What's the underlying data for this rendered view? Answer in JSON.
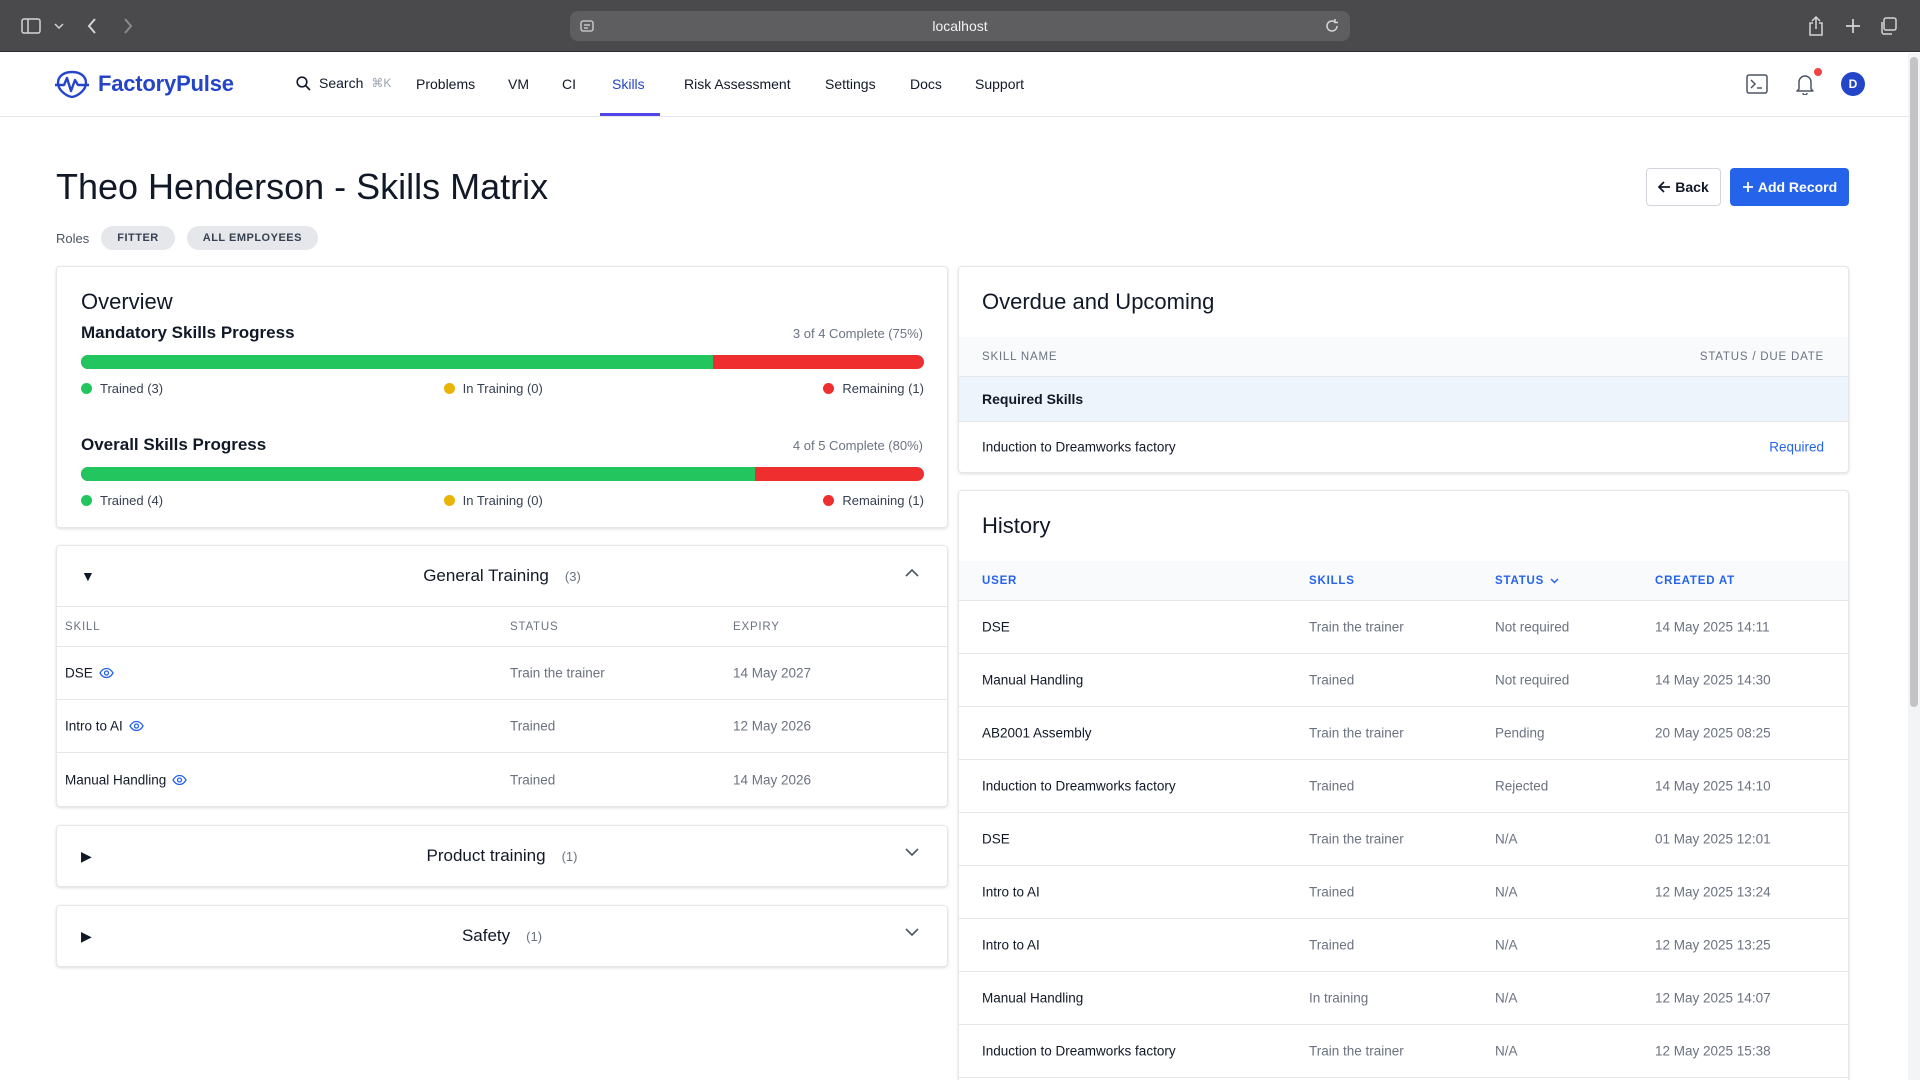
{
  "browser": {
    "url": "localhost"
  },
  "nav": {
    "brand": "FactoryPulse",
    "search_label": "Search",
    "search_shortcut": "⌘K",
    "items": [
      "Problems",
      "VM",
      "CI",
      "Skills",
      "Risk Assessment",
      "Settings",
      "Docs",
      "Support"
    ],
    "active": "Skills",
    "avatar_initial": "D"
  },
  "header": {
    "title": "Theo Henderson - Skills Matrix",
    "roles_label": "Roles",
    "roles": [
      "FITTER",
      "ALL EMPLOYEES"
    ],
    "back_label": "Back",
    "add_label": "Add Record"
  },
  "overview": {
    "title": "Overview",
    "mandatory": {
      "label": "Mandatory Skills Progress",
      "summary": "3 of 4 Complete (75%)",
      "fraction": 0.75,
      "trained": "Trained (3)",
      "in_training": "In Training (0)",
      "remaining": "Remaining (1)"
    },
    "overall": {
      "label": "Overall Skills Progress",
      "summary": "4 of 5 Complete (80%)",
      "fraction": 0.8,
      "trained": "Trained (4)",
      "in_training": "In Training (0)",
      "remaining": "Remaining (1)"
    },
    "colors": {
      "trained": "#22c55e",
      "in_training": "#eab308",
      "remaining": "#ef2f2f"
    }
  },
  "general_training": {
    "title": "General Training",
    "count": "(3)",
    "columns": [
      "SKILL",
      "STATUS",
      "EXPIRY"
    ],
    "rows": [
      {
        "skill": "DSE",
        "status": "Train the trainer",
        "expiry": "14 May 2027"
      },
      {
        "skill": "Intro to AI",
        "status": "Trained",
        "expiry": "12 May 2026"
      },
      {
        "skill": "Manual Handling",
        "status": "Trained",
        "expiry": "14 May 2026"
      }
    ]
  },
  "product_training": {
    "title": "Product training",
    "count": "(1)"
  },
  "safety": {
    "title": "Safety",
    "count": "(1)"
  },
  "overdue": {
    "title": "Overdue and Upcoming",
    "col_skill": "SKILL NAME",
    "col_status": "STATUS / DUE DATE",
    "group": "Required Skills",
    "rows": [
      {
        "skill": "Induction to Dreamworks factory",
        "status": "Required"
      }
    ]
  },
  "history": {
    "title": "History",
    "columns": [
      "USER",
      "SKILLS",
      "STATUS",
      "CREATED AT"
    ],
    "rows": [
      {
        "user": "DSE",
        "skills": "Train the trainer",
        "status": "Not required",
        "created": "14 May 2025 14:11"
      },
      {
        "user": "Manual Handling",
        "skills": "Trained",
        "status": "Not required",
        "created": "14 May 2025 14:30"
      },
      {
        "user": "AB2001 Assembly",
        "skills": "Train the trainer",
        "status": "Pending",
        "created": "20 May 2025 08:25"
      },
      {
        "user": "Induction to Dreamworks factory",
        "skills": "Trained",
        "status": "Rejected",
        "created": "14 May 2025 14:10"
      },
      {
        "user": "DSE",
        "skills": "Train the trainer",
        "status": "N/A",
        "created": "01 May 2025 12:01"
      },
      {
        "user": "Intro to AI",
        "skills": "Trained",
        "status": "N/A",
        "created": "12 May 2025 13:24"
      },
      {
        "user": "Intro to AI",
        "skills": "Trained",
        "status": "N/A",
        "created": "12 May 2025 13:25"
      },
      {
        "user": "Manual Handling",
        "skills": "In training",
        "status": "N/A",
        "created": "12 May 2025 14:07"
      },
      {
        "user": "Induction to Dreamworks factory",
        "skills": "Train the trainer",
        "status": "N/A",
        "created": "12 May 2025 15:38"
      }
    ]
  }
}
